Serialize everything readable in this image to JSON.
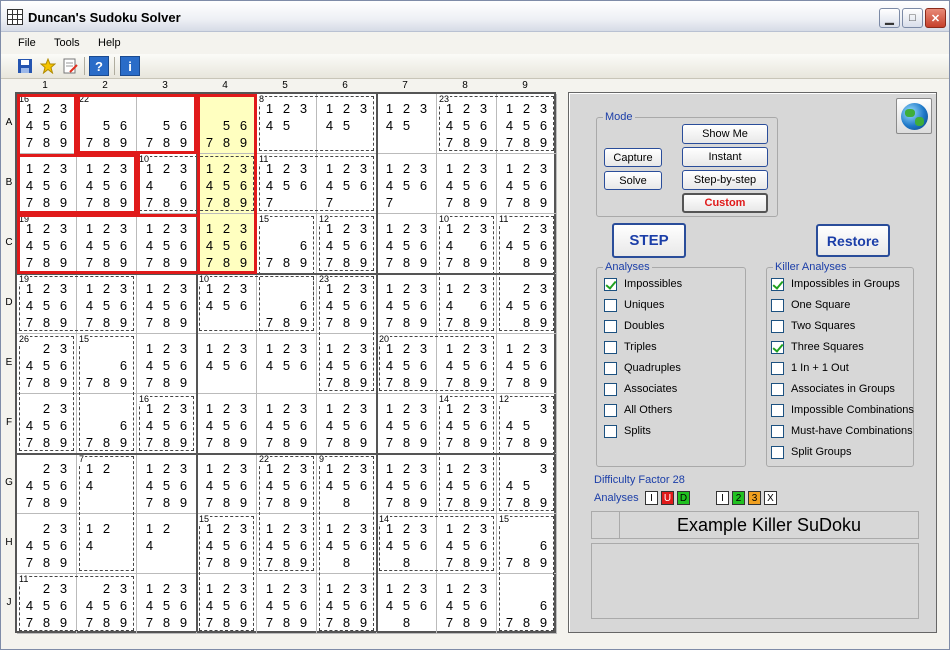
{
  "window": {
    "title": "Duncan's Sudoku Solver",
    "min_icon": "minimize-icon",
    "max_icon": "maximize-icon",
    "close_icon": "close-icon"
  },
  "menu": [
    "File",
    "Tools",
    "Help"
  ],
  "toolbar": {
    "icons": [
      "save-icon",
      "favorite-star-icon",
      "edit-document-icon",
      "help-question-icon",
      "info-icon"
    ],
    "help_label": "?",
    "info_label": "i"
  },
  "grid": {
    "col_labels": [
      "1",
      "2",
      "3",
      "4",
      "5",
      "6",
      "7",
      "8",
      "9"
    ],
    "row_labels": [
      "A",
      "B",
      "C",
      "D",
      "E",
      "F",
      "G",
      "H",
      "J"
    ],
    "cells": [
      [
        "123456789",
        "56789",
        "56789",
        "56789",
        "12345",
        "12345",
        "12345",
        "123456789",
        "123456789"
      ],
      [
        "123456789",
        "123456789",
        "12346789",
        "123456789",
        "1234567",
        "1234567",
        "1234567",
        "123456789",
        "123456789"
      ],
      [
        "123456789",
        "123456789",
        "123456789",
        "123456789",
        "6789",
        "123456789",
        "123456789",
        "12346789",
        "2345689"
      ],
      [
        "123456789",
        "123456789",
        "123456789",
        "123456",
        "6789",
        "123456789",
        "123456789",
        "12346789",
        "2345689"
      ],
      [
        "23456789",
        "6789",
        "123456789",
        "123456",
        "123456",
        "123456789",
        "123456789",
        "123456789",
        "123456789"
      ],
      [
        "23456789",
        "6789",
        "123456789",
        "123456789",
        "123456789",
        "123456789",
        "123456789",
        "123456789",
        "345789"
      ],
      [
        "23456789",
        "124",
        "123456789",
        "123456789",
        "123456789",
        "1234568",
        "123456789",
        "123456789",
        "345789"
      ],
      [
        "23456789",
        "124",
        "124",
        "123456789",
        "123456789",
        "1234568",
        "1234568",
        "123456789",
        "6789"
      ],
      [
        "23456789",
        "23456789",
        "123456789",
        "123456789",
        "123456789",
        "123456789",
        "1234568",
        "123456789",
        "6789"
      ]
    ],
    "cage_sums": [
      {
        "r": 0,
        "c": 0,
        "v": "16"
      },
      {
        "r": 0,
        "c": 1,
        "v": "22"
      },
      {
        "r": 0,
        "c": 4,
        "v": "8"
      },
      {
        "r": 0,
        "c": 7,
        "v": "23"
      },
      {
        "r": 1,
        "c": 2,
        "v": "10"
      },
      {
        "r": 1,
        "c": 4,
        "v": "11"
      },
      {
        "r": 2,
        "c": 0,
        "v": "19"
      },
      {
        "r": 2,
        "c": 4,
        "v": "15"
      },
      {
        "r": 2,
        "c": 5,
        "v": "12"
      },
      {
        "r": 2,
        "c": 7,
        "v": "10"
      },
      {
        "r": 2,
        "c": 8,
        "v": "11"
      },
      {
        "r": 3,
        "c": 0,
        "v": "19"
      },
      {
        "r": 3,
        "c": 3,
        "v": "10"
      },
      {
        "r": 3,
        "c": 5,
        "v": "23"
      },
      {
        "r": 4,
        "c": 0,
        "v": "26"
      },
      {
        "r": 4,
        "c": 1,
        "v": "15"
      },
      {
        "r": 4,
        "c": 6,
        "v": "20"
      },
      {
        "r": 5,
        "c": 2,
        "v": "16"
      },
      {
        "r": 5,
        "c": 7,
        "v": "14"
      },
      {
        "r": 5,
        "c": 8,
        "v": "12"
      },
      {
        "r": 6,
        "c": 1,
        "v": "7"
      },
      {
        "r": 6,
        "c": 4,
        "v": "22"
      },
      {
        "r": 6,
        "c": 5,
        "v": "9"
      },
      {
        "r": 7,
        "c": 3,
        "v": "15"
      },
      {
        "r": 7,
        "c": 6,
        "v": "14"
      },
      {
        "r": 7,
        "c": 8,
        "v": "15"
      },
      {
        "r": 8,
        "c": 0,
        "v": "11"
      }
    ],
    "highlight": [
      [
        0,
        3
      ],
      [
        1,
        3
      ],
      [
        2,
        3
      ]
    ],
    "highlight_color": "#ffffc0",
    "cage_border_color": "#e01a1a"
  },
  "panel": {
    "globe_icon": "globe-icon",
    "mode": {
      "label": "Mode",
      "capture": "Capture",
      "solve": "Solve",
      "show_me": "Show Me",
      "instant": "Instant",
      "step_by_step": "Step-by-step",
      "custom": "Custom",
      "custom_color": "#e01a1a"
    },
    "step": "STEP",
    "restore": "Restore",
    "analyses": {
      "label": "Analyses",
      "items": [
        {
          "label": "Impossibles",
          "checked": true
        },
        {
          "label": "Uniques",
          "checked": false
        },
        {
          "label": "Doubles",
          "checked": false
        },
        {
          "label": "Triples",
          "checked": false
        },
        {
          "label": "Quadruples",
          "checked": false
        },
        {
          "label": "Associates",
          "checked": false
        },
        {
          "label": "All Others",
          "checked": false
        },
        {
          "label": "Splits",
          "checked": false
        }
      ]
    },
    "killer": {
      "label": "Killer Analyses",
      "items": [
        {
          "label": "Impossibles in Groups",
          "checked": true
        },
        {
          "label": "One Square",
          "checked": false
        },
        {
          "label": "Two Squares",
          "checked": false
        },
        {
          "label": "Three Squares",
          "checked": true
        },
        {
          "label": "1 In + 1 Out",
          "checked": false
        },
        {
          "label": "Associates in Groups",
          "checked": false
        },
        {
          "label": "Impossible Combinations",
          "checked": false
        },
        {
          "label": "Must-have Combinations",
          "checked": false
        },
        {
          "label": "Split Groups",
          "checked": false
        }
      ]
    },
    "difficulty": "Difficulty Factor 28",
    "analyses_short": "Analyses",
    "badges1": [
      {
        "t": "I",
        "bg": "#ffffff",
        "fg": "#000"
      },
      {
        "t": "U",
        "bg": "#e01a1a",
        "fg": "#fff"
      },
      {
        "t": "D",
        "bg": "#21c121",
        "fg": "#000"
      }
    ],
    "badges2": [
      {
        "t": "I",
        "bg": "#ffffff",
        "fg": "#000"
      },
      {
        "t": "2",
        "bg": "#21c121",
        "fg": "#000"
      },
      {
        "t": "3",
        "bg": "#f0a020",
        "fg": "#000"
      },
      {
        "t": "X",
        "bg": "#ffffff",
        "fg": "#000"
      }
    ],
    "puzzle_name": "Example Killer SuDoku"
  }
}
